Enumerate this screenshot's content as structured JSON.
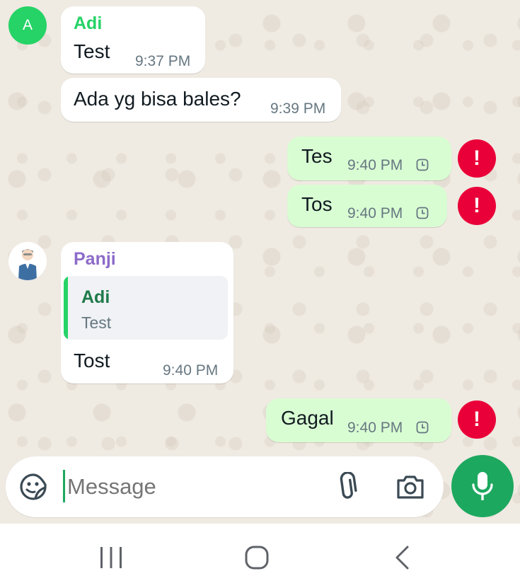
{
  "messages": [
    {
      "sender": "Adi",
      "avatar_letter": "A",
      "text": "Test",
      "time": "9:37 PM"
    },
    {
      "text": "Ada yg bisa bales?",
      "time": "9:39 PM"
    },
    {
      "text": "Tes",
      "time": "9:40 PM",
      "status": "pending",
      "error": "!"
    },
    {
      "text": "Tos",
      "time": "9:40 PM",
      "status": "pending",
      "error": "!"
    },
    {
      "sender": "Panji",
      "quote": {
        "sender": "Adi",
        "text": "Test"
      },
      "text": "Tost",
      "time": "9:40 PM"
    },
    {
      "text": "Gagal",
      "time": "9:40 PM",
      "status": "pending",
      "error": "!"
    }
  ],
  "composer": {
    "placeholder": "Message"
  },
  "icons": {
    "sticker": "sticker-icon",
    "attach": "paperclip-icon",
    "camera": "camera-icon",
    "mic": "microphone-icon",
    "clock": "clock-icon",
    "error": "error-icon"
  },
  "colors": {
    "adi_name": "#25d366",
    "panji_name": "#8c6bc9",
    "quote_name": "#1f7a4a",
    "outgoing_bubble": "#d9fdd3",
    "error": "#ea0038",
    "mic_button": "#1da85f"
  },
  "nav": [
    "recent-apps",
    "home",
    "back"
  ]
}
